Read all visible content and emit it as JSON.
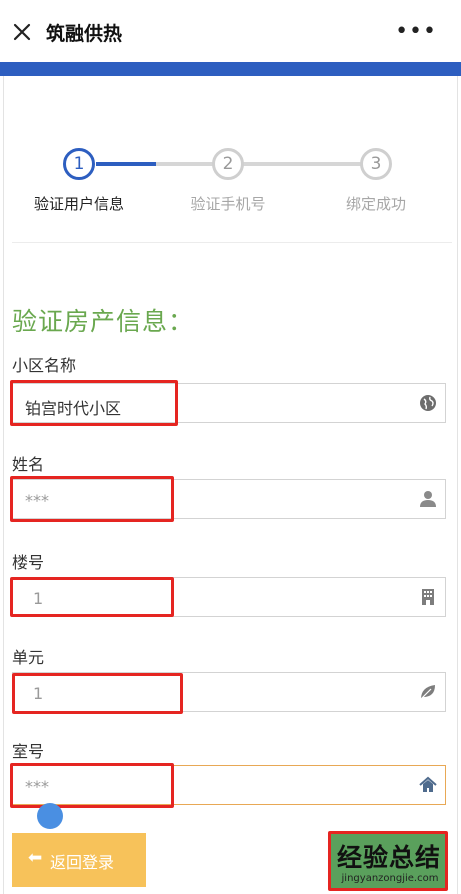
{
  "titlebar": {
    "title": "筑融供热",
    "more": "•••"
  },
  "steps": [
    {
      "num": "1",
      "label": "验证用户信息",
      "active": true
    },
    {
      "num": "2",
      "label": "验证手机号",
      "active": false
    },
    {
      "num": "3",
      "label": "绑定成功",
      "active": false
    }
  ],
  "form": {
    "heading": "验证房产信息：",
    "community": {
      "label": "小区名称",
      "value": "铂宫时代小区",
      "icon": "globe-icon"
    },
    "name": {
      "label": "姓名",
      "value": "***",
      "icon": "user-icon"
    },
    "building": {
      "label": "楼号",
      "value": "1",
      "icon": "building-icon"
    },
    "unit": {
      "label": "单元",
      "value": "1",
      "icon": "leaf-icon"
    },
    "room": {
      "label": "室号",
      "value": "***",
      "icon": "home-icon"
    }
  },
  "buttons": {
    "back_label": "返回登录",
    "back_arrow": "⬅"
  },
  "watermark": {
    "main": "经验总结",
    "sub": "jingyanzongjie.com"
  },
  "colors": {
    "brand_blue": "#2d5ec0",
    "heading_green": "#6aa84f",
    "back_button": "#f7c25a",
    "submit_button": "#5aa05c",
    "highlight_red": "#e52521"
  }
}
